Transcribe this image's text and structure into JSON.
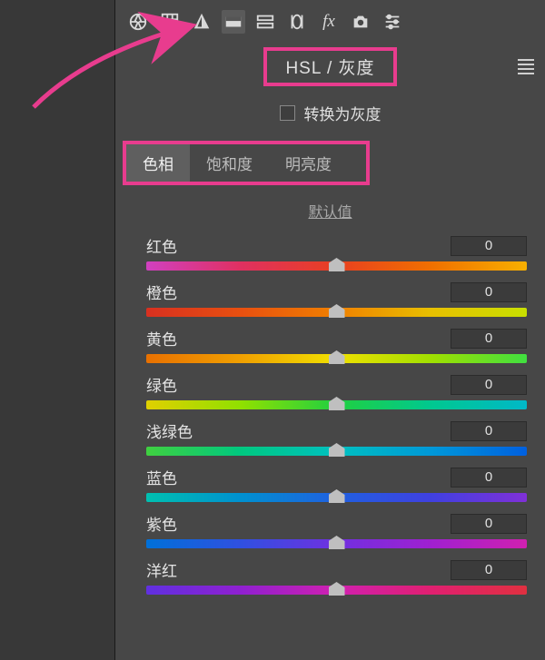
{
  "header": {
    "title": "HSL / 灰度"
  },
  "checkbox": {
    "label": "转换为灰度"
  },
  "tabs": {
    "items": [
      {
        "label": "色相",
        "active": true
      },
      {
        "label": "饱和度",
        "active": false
      },
      {
        "label": "明亮度",
        "active": false
      }
    ]
  },
  "default_link": "默认值",
  "sliders": [
    {
      "label": "红色",
      "value": "0",
      "gradient": "linear-gradient(to right,#d040c0,#e03060,#e84020,#f07000,#f8b000)"
    },
    {
      "label": "橙色",
      "value": "0",
      "gradient": "linear-gradient(to right,#d83020,#e85010,#f08000,#e8c000,#c8e000)"
    },
    {
      "label": "黄色",
      "value": "0",
      "gradient": "linear-gradient(to right,#e87000,#f0a000,#f0e000,#a0e000,#40e040)"
    },
    {
      "label": "绿色",
      "value": "0",
      "gradient": "linear-gradient(to right,#e0d000,#90e000,#20d040,#00c890,#00b8c8)"
    },
    {
      "label": "浅绿色",
      "value": "0",
      "gradient": "linear-gradient(to right,#40d040,#00c880,#00c0c0,#0098d8,#0060e0)"
    },
    {
      "label": "蓝色",
      "value": "0",
      "gradient": "linear-gradient(to right,#00c0b0,#0090d0,#2060e0,#4040e0,#8030d8)"
    },
    {
      "label": "紫色",
      "value": "0",
      "gradient": "linear-gradient(to right,#0070d8,#3050e0,#7030e0,#a020d0,#d020b0)"
    },
    {
      "label": "洋红",
      "value": "0",
      "gradient": "linear-gradient(to right,#6030e0,#9020d0,#d020b0,#e02070,#e03040)"
    }
  ],
  "toolbar_icons": [
    "aperture-icon",
    "grid-icon",
    "tone-icon",
    "gradient-icon",
    "split-icon",
    "detail-icon",
    "fx-icon",
    "camera-icon",
    "sliders-icon"
  ]
}
